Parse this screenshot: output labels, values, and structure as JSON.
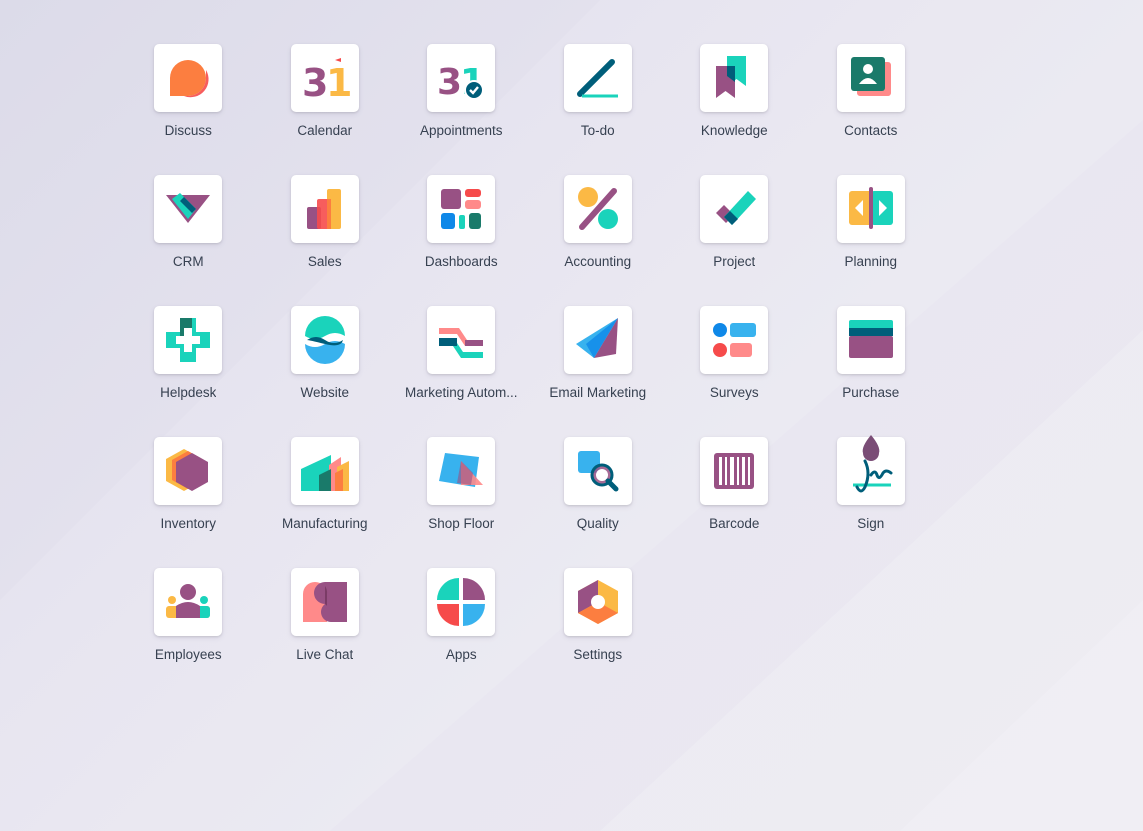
{
  "apps": [
    {
      "label": "Discuss",
      "icon": "discuss-icon"
    },
    {
      "label": "Calendar",
      "icon": "calendar-icon"
    },
    {
      "label": "Appointments",
      "icon": "appointments-icon"
    },
    {
      "label": "To-do",
      "icon": "todo-icon"
    },
    {
      "label": "Knowledge",
      "icon": "knowledge-icon"
    },
    {
      "label": "Contacts",
      "icon": "contacts-icon"
    },
    {
      "label": "CRM",
      "icon": "crm-icon"
    },
    {
      "label": "Sales",
      "icon": "sales-icon"
    },
    {
      "label": "Dashboards",
      "icon": "dashboards-icon"
    },
    {
      "label": "Accounting",
      "icon": "accounting-icon"
    },
    {
      "label": "Project",
      "icon": "project-icon"
    },
    {
      "label": "Planning",
      "icon": "planning-icon"
    },
    {
      "label": "Helpdesk",
      "icon": "helpdesk-icon"
    },
    {
      "label": "Website",
      "icon": "website-icon"
    },
    {
      "label": "Marketing Autom...",
      "icon": "marketing-automation-icon"
    },
    {
      "label": "Email Marketing",
      "icon": "email-marketing-icon"
    },
    {
      "label": "Surveys",
      "icon": "surveys-icon"
    },
    {
      "label": "Purchase",
      "icon": "purchase-icon"
    },
    {
      "label": "Inventory",
      "icon": "inventory-icon"
    },
    {
      "label": "Manufacturing",
      "icon": "manufacturing-icon"
    },
    {
      "label": "Shop Floor",
      "icon": "shop-floor-icon"
    },
    {
      "label": "Quality",
      "icon": "quality-icon"
    },
    {
      "label": "Barcode",
      "icon": "barcode-icon"
    },
    {
      "label": "Sign",
      "icon": "sign-icon"
    },
    {
      "label": "Employees",
      "icon": "employees-icon"
    },
    {
      "label": "Live Chat",
      "icon": "live-chat-icon"
    },
    {
      "label": "Apps",
      "icon": "apps-icon"
    },
    {
      "label": "Settings",
      "icon": "settings-icon"
    }
  ],
  "calendar_day": "31",
  "colors": {
    "purple": "#985184",
    "teal": "#1ad3bb",
    "dark_teal": "#005e7a",
    "orange": "#fc7e40",
    "yellow": "#fbb945",
    "red": "#f64b4b",
    "blue": "#38b2ee",
    "pink": "#ff8a8a"
  }
}
